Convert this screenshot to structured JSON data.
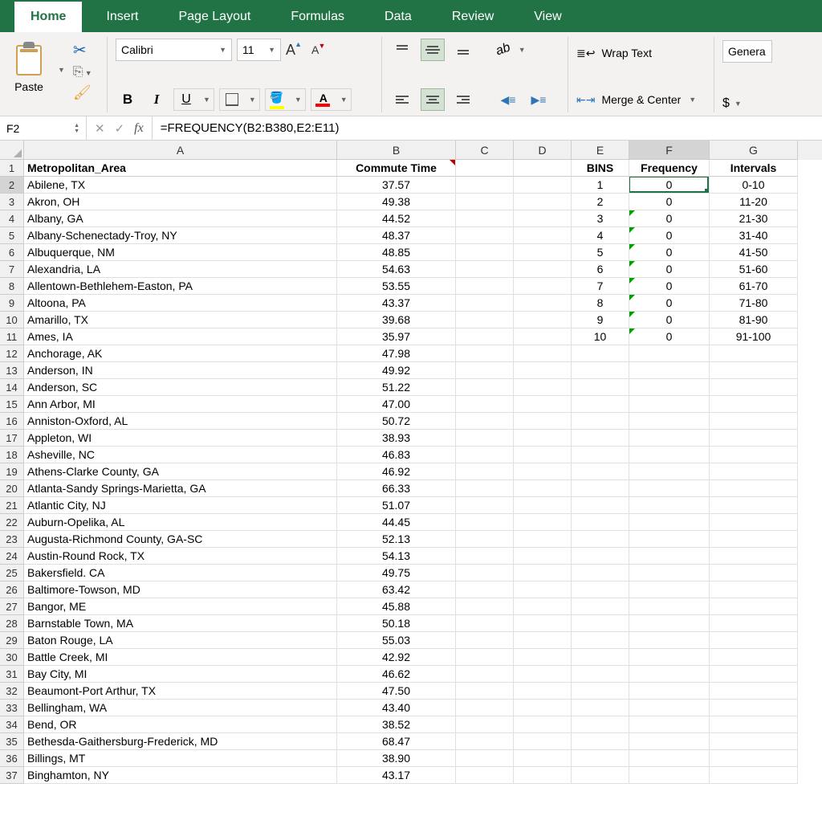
{
  "tabs": [
    "Home",
    "Insert",
    "Page Layout",
    "Formulas",
    "Data",
    "Review",
    "View"
  ],
  "active_tab": 0,
  "ribbon": {
    "paste_label": "Paste",
    "font_name": "Calibri",
    "font_size": "11",
    "bold": "B",
    "italic": "I",
    "underline": "U",
    "wrap_text": "Wrap Text",
    "merge_center": "Merge & Center",
    "number_format": "Genera",
    "dollar": "$"
  },
  "name_box": "F2",
  "fx_label": "fx",
  "formula": "=FREQUENCY(B2:B380,E2:E11)",
  "columns": [
    "A",
    "B",
    "C",
    "D",
    "E",
    "F",
    "G"
  ],
  "headers": {
    "A": "Metropolitan_Area",
    "B": "Commute Time",
    "C": "",
    "D": "",
    "E": "BINS",
    "F": "Frequency",
    "G": "Intervals"
  },
  "rows": [
    {
      "n": 2,
      "a": "Abilene, TX",
      "b": "37.57",
      "e": "1",
      "f": "0",
      "g": "0-10"
    },
    {
      "n": 3,
      "a": "Akron, OH",
      "b": "49.38",
      "e": "2",
      "f": "0",
      "g": "11-20"
    },
    {
      "n": 4,
      "a": "Albany, GA",
      "b": "44.52",
      "e": "3",
      "f": "0",
      "g": "21-30",
      "tri": true
    },
    {
      "n": 5,
      "a": "Albany-Schenectady-Troy, NY",
      "b": "48.37",
      "e": "4",
      "f": "0",
      "g": "31-40",
      "tri": true
    },
    {
      "n": 6,
      "a": "Albuquerque, NM",
      "b": "48.85",
      "e": "5",
      "f": "0",
      "g": "41-50",
      "tri": true
    },
    {
      "n": 7,
      "a": "Alexandria, LA",
      "b": "54.63",
      "e": "6",
      "f": "0",
      "g": "51-60",
      "tri": true
    },
    {
      "n": 8,
      "a": "Allentown-Bethlehem-Easton, PA",
      "b": "53.55",
      "e": "7",
      "f": "0",
      "g": "61-70",
      "tri": true
    },
    {
      "n": 9,
      "a": "Altoona, PA",
      "b": "43.37",
      "e": "8",
      "f": "0",
      "g": "71-80",
      "tri": true
    },
    {
      "n": 10,
      "a": "Amarillo, TX",
      "b": "39.68",
      "e": "9",
      "f": "0",
      "g": "81-90",
      "tri": true
    },
    {
      "n": 11,
      "a": "Ames, IA",
      "b": "35.97",
      "e": "10",
      "f": "0",
      "g": "91-100",
      "tri": true
    },
    {
      "n": 12,
      "a": "Anchorage, AK",
      "b": "47.98"
    },
    {
      "n": 13,
      "a": "Anderson, IN",
      "b": "49.92"
    },
    {
      "n": 14,
      "a": "Anderson, SC",
      "b": "51.22"
    },
    {
      "n": 15,
      "a": "Ann Arbor, MI",
      "b": "47.00"
    },
    {
      "n": 16,
      "a": "Anniston-Oxford, AL",
      "b": "50.72"
    },
    {
      "n": 17,
      "a": "Appleton, WI",
      "b": "38.93"
    },
    {
      "n": 18,
      "a": "Asheville, NC",
      "b": "46.83"
    },
    {
      "n": 19,
      "a": "Athens-Clarke County, GA",
      "b": "46.92"
    },
    {
      "n": 20,
      "a": "Atlanta-Sandy Springs-Marietta, GA",
      "b": "66.33"
    },
    {
      "n": 21,
      "a": "Atlantic City, NJ",
      "b": "51.07"
    },
    {
      "n": 22,
      "a": "Auburn-Opelika, AL",
      "b": "44.45"
    },
    {
      "n": 23,
      "a": "Augusta-Richmond County, GA-SC",
      "b": "52.13"
    },
    {
      "n": 24,
      "a": "Austin-Round Rock, TX",
      "b": "54.13"
    },
    {
      "n": 25,
      "a": "Bakersfield. CA",
      "b": "49.75"
    },
    {
      "n": 26,
      "a": "Baltimore-Towson, MD",
      "b": "63.42"
    },
    {
      "n": 27,
      "a": "Bangor, ME",
      "b": "45.88"
    },
    {
      "n": 28,
      "a": "Barnstable Town, MA",
      "b": "50.18"
    },
    {
      "n": 29,
      "a": "Baton Rouge, LA",
      "b": "55.03"
    },
    {
      "n": 30,
      "a": "Battle Creek, MI",
      "b": "42.92"
    },
    {
      "n": 31,
      "a": "Bay City, MI",
      "b": "46.62"
    },
    {
      "n": 32,
      "a": "Beaumont-Port Arthur, TX",
      "b": "47.50"
    },
    {
      "n": 33,
      "a": "Bellingham, WA",
      "b": "43.40"
    },
    {
      "n": 34,
      "a": "Bend, OR",
      "b": "38.52"
    },
    {
      "n": 35,
      "a": "Bethesda-Gaithersburg-Frederick, MD",
      "b": "68.47"
    },
    {
      "n": 36,
      "a": "Billings, MT",
      "b": "38.90"
    },
    {
      "n": 37,
      "a": "Binghamton, NY",
      "b": "43.17"
    }
  ],
  "active_cell": {
    "col": "F",
    "row": 2
  }
}
